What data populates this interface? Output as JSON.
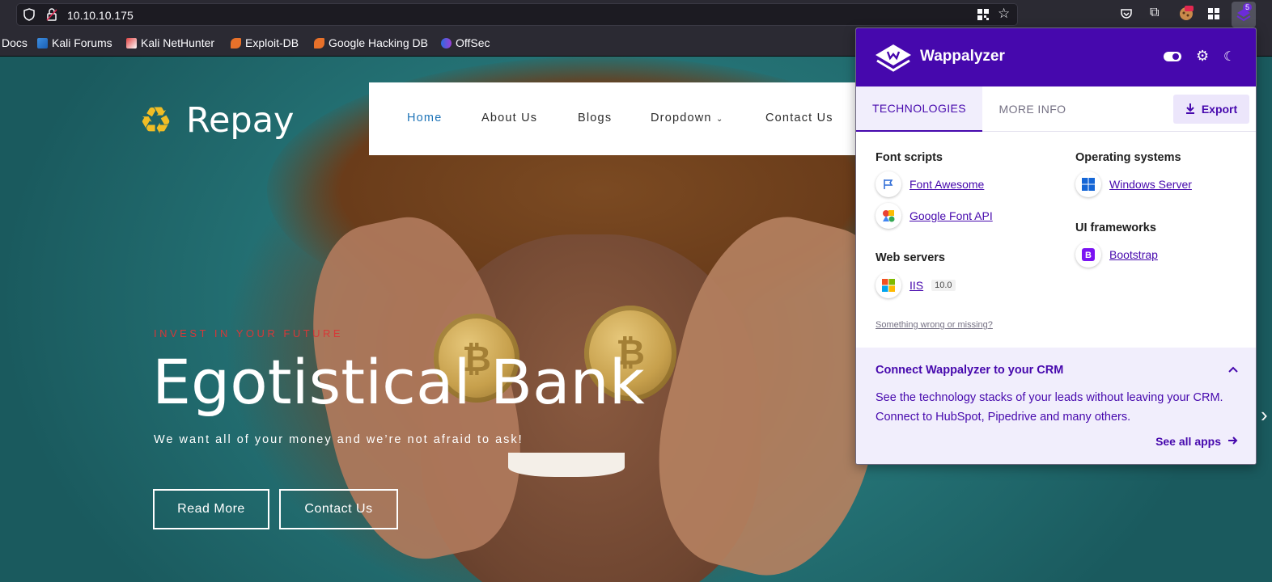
{
  "browser": {
    "url": "10.10.10.175",
    "extension_badge": "5",
    "bookmarks": [
      {
        "label": "Docs"
      },
      {
        "label": "Kali Forums"
      },
      {
        "label": "Kali NetHunter"
      },
      {
        "label": "Exploit-DB"
      },
      {
        "label": "Google Hacking DB"
      },
      {
        "label": "OffSec"
      }
    ]
  },
  "site": {
    "brand": "Repay",
    "nav": [
      "Home",
      "About Us",
      "Blogs",
      "Dropdown",
      "Contact Us"
    ],
    "tagline": "INVEST IN YOUR FUTURE",
    "headline": "Egotistical Bank",
    "subline": "We want all of your money and we’re not afraid to ask!",
    "buttons": {
      "read_more": "Read More",
      "contact": "Contact Us"
    },
    "accent_color": "#d63838",
    "nav_active_color": "#1e74b8"
  },
  "wappalyzer": {
    "title": "Wappalyzer",
    "tabs": {
      "technologies": "TECHNOLOGIES",
      "more_info": "MORE INFO"
    },
    "export_label": "Export",
    "categories": {
      "font_scripts": {
        "label": "Font scripts",
        "items": [
          "Font Awesome",
          "Google Font API"
        ]
      },
      "web_servers": {
        "label": "Web servers",
        "items": [
          {
            "name": "IIS",
            "version": "10.0"
          }
        ]
      },
      "operating_systems": {
        "label": "Operating systems",
        "items": [
          "Windows Server"
        ]
      },
      "ui_frameworks": {
        "label": "UI frameworks",
        "items": [
          "Bootstrap"
        ]
      }
    },
    "feedback_link": "Something wrong or missing?",
    "crm": {
      "title": "Connect Wappalyzer to your CRM",
      "text": "See the technology stacks of your leads without leaving your CRM. Connect to HubSpot, Pipedrive and many others.",
      "link": "See all apps"
    },
    "brand_color": "#4608ad"
  }
}
